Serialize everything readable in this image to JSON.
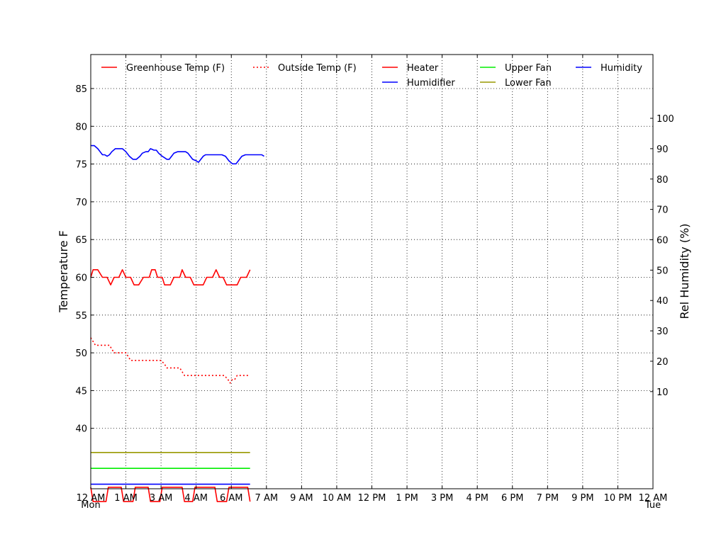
{
  "chart_data": {
    "type": "line",
    "title": "",
    "xlabel": "",
    "ylabel": "Temperature F",
    "y2label": "Rel Humidity (%)",
    "xlim": [
      0,
      24
    ],
    "ylim": [
      32,
      89.5
    ],
    "y2lim": [
      -22,
      121
    ],
    "y_ticks": [
      40,
      45,
      50,
      55,
      60,
      65,
      70,
      75,
      80,
      85
    ],
    "y2_ticks": [
      10,
      20,
      30,
      40,
      50,
      60,
      70,
      80,
      90,
      100
    ],
    "x_ticks": [
      {
        "x": 0,
        "label": "12 AM",
        "sub": "Mon"
      },
      {
        "x": 1.5,
        "label": "1 AM"
      },
      {
        "x": 3,
        "label": "3 AM"
      },
      {
        "x": 4.5,
        "label": "4 AM"
      },
      {
        "x": 6,
        "label": "6 AM"
      },
      {
        "x": 7.5,
        "label": "7 AM"
      },
      {
        "x": 9,
        "label": "9 AM"
      },
      {
        "x": 10.5,
        "label": "10 AM"
      },
      {
        "x": 12,
        "label": "12 PM"
      },
      {
        "x": 13.5,
        "label": "1 PM"
      },
      {
        "x": 15,
        "label": "3 PM"
      },
      {
        "x": 16.5,
        "label": "4 PM"
      },
      {
        "x": 18,
        "label": "6 PM"
      },
      {
        "x": 19.5,
        "label": "7 PM"
      },
      {
        "x": 21,
        "label": "9 PM"
      },
      {
        "x": 22.5,
        "label": "10 PM"
      },
      {
        "x": 24,
        "label": "12 AM",
        "sub": "Tue"
      }
    ],
    "grid": true,
    "legend_position": "top",
    "legend": [
      {
        "name": "Greenhouse Temp (F)",
        "color": "#ff0000",
        "style": "solid"
      },
      {
        "name": "Outside Temp (F)",
        "color": "#ff0000",
        "style": "dotted"
      },
      {
        "name": "Heater",
        "color": "#ff0000",
        "style": "solid"
      },
      {
        "name": "Upper Fan",
        "color": "#00ee00",
        "style": "solid"
      },
      {
        "name": "Humidity",
        "color": "#0000ff",
        "style": "solid"
      },
      {
        "name": "Humidifier",
        "color": "#0000ff",
        "style": "solid"
      },
      {
        "name": "Lower Fan",
        "color": "#999900",
        "style": "solid"
      }
    ],
    "series": [
      {
        "name": "Greenhouse Temp (F)",
        "axis": "left",
        "color": "#ff0000",
        "style": "solid",
        "points": [
          [
            0,
            60
          ],
          [
            0.1,
            61
          ],
          [
            0.3,
            61
          ],
          [
            0.5,
            60
          ],
          [
            0.7,
            60
          ],
          [
            0.85,
            59
          ],
          [
            1.0,
            60
          ],
          [
            1.2,
            60
          ],
          [
            1.35,
            61
          ],
          [
            1.5,
            60
          ],
          [
            1.7,
            60
          ],
          [
            1.85,
            59
          ],
          [
            2.05,
            59
          ],
          [
            2.25,
            60
          ],
          [
            2.5,
            60
          ],
          [
            2.6,
            61
          ],
          [
            2.75,
            61
          ],
          [
            2.85,
            60
          ],
          [
            3.05,
            60
          ],
          [
            3.15,
            59
          ],
          [
            3.4,
            59
          ],
          [
            3.55,
            60
          ],
          [
            3.8,
            60
          ],
          [
            3.9,
            61
          ],
          [
            4.05,
            60
          ],
          [
            4.25,
            60
          ],
          [
            4.4,
            59
          ],
          [
            4.8,
            59
          ],
          [
            4.95,
            60
          ],
          [
            5.2,
            60
          ],
          [
            5.35,
            61
          ],
          [
            5.5,
            60
          ],
          [
            5.65,
            60
          ],
          [
            5.8,
            59
          ],
          [
            6.25,
            59
          ],
          [
            6.4,
            60
          ],
          [
            6.65,
            60
          ],
          [
            6.8,
            61
          ]
        ]
      },
      {
        "name": "Outside Temp (F)",
        "axis": "left",
        "color": "#ff0000",
        "style": "dotted",
        "points": [
          [
            0,
            52
          ],
          [
            0.1,
            51.5
          ],
          [
            0.2,
            51
          ],
          [
            0.8,
            51
          ],
          [
            0.9,
            50.5
          ],
          [
            1.0,
            50
          ],
          [
            1.5,
            50
          ],
          [
            1.6,
            49.5
          ],
          [
            1.7,
            49
          ],
          [
            3.0,
            49
          ],
          [
            3.15,
            48.5
          ],
          [
            3.25,
            48
          ],
          [
            3.8,
            48
          ],
          [
            3.9,
            47.5
          ],
          [
            4.0,
            47
          ],
          [
            5.7,
            47
          ],
          [
            5.85,
            46.5
          ],
          [
            5.95,
            46
          ],
          [
            6.05,
            46.5
          ],
          [
            6.15,
            46.5
          ],
          [
            6.25,
            47
          ],
          [
            6.8,
            47
          ]
        ]
      },
      {
        "name": "Humidity",
        "axis": "right",
        "color": "#0000ff",
        "style": "solid",
        "points": [
          [
            0,
            91
          ],
          [
            0.15,
            91
          ],
          [
            0.3,
            90
          ],
          [
            0.4,
            89
          ],
          [
            0.5,
            88
          ],
          [
            0.6,
            88
          ],
          [
            0.7,
            87.5
          ],
          [
            0.8,
            88
          ],
          [
            0.9,
            89
          ],
          [
            1.05,
            90
          ],
          [
            1.35,
            90
          ],
          [
            1.5,
            89
          ],
          [
            1.65,
            87.5
          ],
          [
            1.8,
            86.5
          ],
          [
            1.95,
            86.5
          ],
          [
            2.1,
            87.5
          ],
          [
            2.2,
            88.5
          ],
          [
            2.35,
            89
          ],
          [
            2.45,
            89
          ],
          [
            2.55,
            90
          ],
          [
            2.7,
            89.5
          ],
          [
            2.8,
            89.5
          ],
          [
            2.9,
            88.5
          ],
          [
            3.05,
            87.5
          ],
          [
            3.15,
            87
          ],
          [
            3.25,
            86.5
          ],
          [
            3.35,
            86.5
          ],
          [
            3.45,
            87.5
          ],
          [
            3.55,
            88.5
          ],
          [
            3.7,
            89
          ],
          [
            4.05,
            89
          ],
          [
            4.15,
            88.5
          ],
          [
            4.25,
            87.5
          ],
          [
            4.35,
            86.5
          ],
          [
            4.5,
            86
          ],
          [
            4.6,
            85.5
          ],
          [
            4.7,
            86.5
          ],
          [
            4.8,
            87.5
          ],
          [
            4.9,
            88
          ],
          [
            5.1,
            88
          ],
          [
            5.35,
            88
          ],
          [
            5.6,
            88
          ],
          [
            5.75,
            87.5
          ],
          [
            5.9,
            86
          ],
          [
            6.05,
            85
          ],
          [
            6.2,
            85
          ],
          [
            6.3,
            86
          ],
          [
            6.45,
            87.5
          ],
          [
            6.6,
            88
          ],
          [
            6.75,
            88
          ],
          [
            7.0,
            88
          ],
          [
            7.15,
            88
          ],
          [
            7.3,
            88
          ],
          [
            7.4,
            87.5
          ]
        ]
      },
      {
        "name": "Lower Fan",
        "axis": "left",
        "color": "#999900",
        "style": "solid",
        "points": [
          [
            0,
            36.8
          ],
          [
            6.8,
            36.8
          ]
        ]
      },
      {
        "name": "Upper Fan",
        "axis": "left",
        "color": "#00ee00",
        "style": "solid",
        "points": [
          [
            0,
            34.7
          ],
          [
            6.8,
            34.7
          ]
        ]
      },
      {
        "name": "Humidifier",
        "axis": "left",
        "color": "#0000ff",
        "style": "solid",
        "points": [
          [
            0,
            32.6
          ],
          [
            6.8,
            32.6
          ]
        ]
      },
      {
        "name": "Heater",
        "axis": "left",
        "color": "#ff0000",
        "style": "solid",
        "points": [
          [
            0,
            32.2
          ],
          [
            0.1,
            30.3
          ],
          [
            0.65,
            30.3
          ],
          [
            0.75,
            32.2
          ],
          [
            1.3,
            32.2
          ],
          [
            1.4,
            30.3
          ],
          [
            1.8,
            30.3
          ],
          [
            1.9,
            32.2
          ],
          [
            2.45,
            32.2
          ],
          [
            2.55,
            30.3
          ],
          [
            2.95,
            30.3
          ],
          [
            3.05,
            32.2
          ],
          [
            3.9,
            32.2
          ],
          [
            4.0,
            30.3
          ],
          [
            4.35,
            30.3
          ],
          [
            4.45,
            32.2
          ],
          [
            5.3,
            32.2
          ],
          [
            5.4,
            30.3
          ],
          [
            5.8,
            30.3
          ],
          [
            5.9,
            32.2
          ],
          [
            6.7,
            32.2
          ],
          [
            6.8,
            30.3
          ]
        ]
      }
    ]
  }
}
